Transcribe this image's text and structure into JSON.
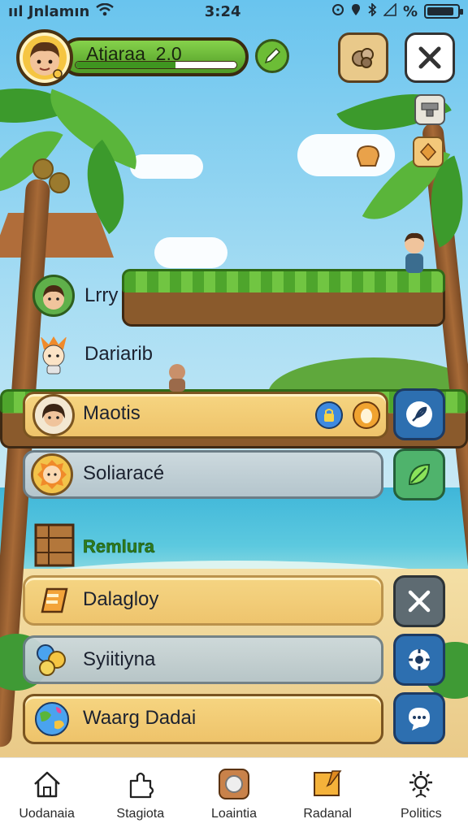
{
  "status_bar": {
    "carrier": "ııl Jnlamın",
    "time": "3:24",
    "battery_text": "%",
    "battery_level": 0.9
  },
  "player": {
    "name": "Atjaraa",
    "level": "2.0",
    "xp_fraction": 0.62
  },
  "characters": [
    {
      "label": "Lrry"
    },
    {
      "label": "Dariarib"
    },
    {
      "label": "Maotis"
    },
    {
      "label": "Soliaracé"
    }
  ],
  "section_title": "Remlura",
  "menu": [
    {
      "label": "Dalagloy"
    },
    {
      "label": "Syiitiyna"
    },
    {
      "label": "Waarg Dadai"
    }
  ],
  "bottom_nav": [
    {
      "label": "Uodanaia",
      "icon": "house-icon"
    },
    {
      "label": "Stagiota",
      "icon": "puzzle-icon"
    },
    {
      "label": "Loaintia",
      "icon": "coin-icon"
    },
    {
      "label": "Radanal",
      "icon": "note-icon"
    },
    {
      "label": "Politics",
      "icon": "gear-icon"
    }
  ],
  "colors": {
    "accent_green": "#6cbd36",
    "wood": "#eec36a",
    "action_blue": "#2d6fb0"
  }
}
